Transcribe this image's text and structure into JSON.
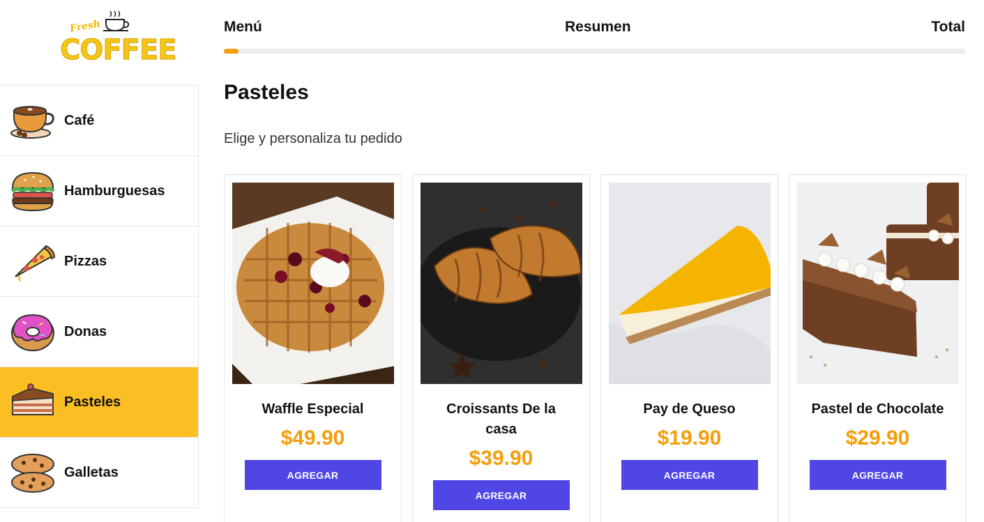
{
  "brand": {
    "script_text": "Fresh",
    "name": "COFFEE"
  },
  "sidebar": {
    "items": [
      {
        "label": "Café",
        "icon": "coffee-cup-icon",
        "active": false
      },
      {
        "label": "Hamburguesas",
        "icon": "burger-icon",
        "active": false
      },
      {
        "label": "Pizzas",
        "icon": "pizza-slice-icon",
        "active": false
      },
      {
        "label": "Donas",
        "icon": "donut-icon",
        "active": false
      },
      {
        "label": "Pasteles",
        "icon": "cake-slice-icon",
        "active": true
      },
      {
        "label": "Galletas",
        "icon": "cookies-icon",
        "active": false
      }
    ]
  },
  "steps": {
    "menu": "Menú",
    "summary": "Resumen",
    "total": "Total",
    "progress_fraction": 0.02
  },
  "main": {
    "title": "Pasteles",
    "subtitle": "Elige y personaliza tu pedido"
  },
  "products": [
    {
      "name": "Waffle Especial",
      "price": "$49.90",
      "button": "AGREGAR",
      "image": "waffle-photo"
    },
    {
      "name": "Croissants De la casa",
      "price": "$39.90",
      "button": "AGREGAR",
      "image": "croissants-photo"
    },
    {
      "name": "Pay de Queso",
      "price": "$19.90",
      "button": "AGREGAR",
      "image": "cheesecake-photo"
    },
    {
      "name": "Pastel de Chocolate",
      "price": "$29.90",
      "button": "AGREGAR",
      "image": "chocolate-cake-photo"
    }
  ],
  "colors": {
    "accent": "#fbbf24",
    "price": "#f59e0b",
    "button": "#4f46e5",
    "progress": "#f59e0b"
  }
}
